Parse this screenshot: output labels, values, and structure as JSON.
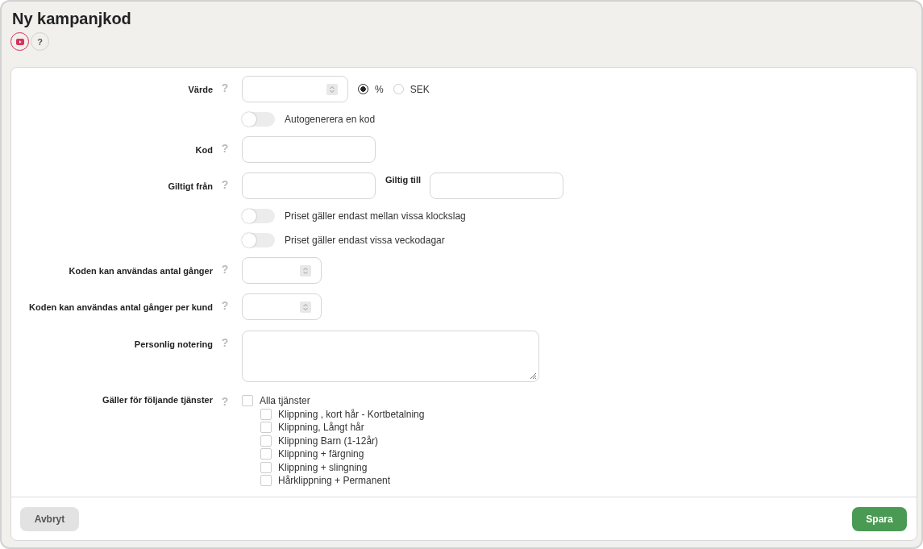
{
  "title": "Ny kampanjkod",
  "help_button": "?",
  "fields": [
    {
      "kind": "value",
      "label": "Värde",
      "help": "?",
      "options": [
        {
          "label": "%",
          "selected": true
        },
        {
          "label": "SEK",
          "selected": false
        }
      ]
    },
    {
      "kind": "toggle",
      "label": "Autogenerera en kod",
      "on": false
    },
    {
      "kind": "text",
      "label": "Kod",
      "help": "?"
    },
    {
      "kind": "daterange",
      "label": "Giltigt från",
      "help": "?",
      "second_label": "Giltig till"
    },
    {
      "kind": "toggle",
      "label": "Priset gäller endast mellan vissa klockslag",
      "on": false
    },
    {
      "kind": "toggle",
      "label": "Priset gäller endast vissa veckodagar",
      "on": false
    },
    {
      "kind": "number",
      "label": "Koden kan användas antal gånger",
      "help": "?"
    },
    {
      "kind": "number",
      "label": "Koden kan användas antal gånger per kund",
      "help": "?"
    },
    {
      "kind": "textarea",
      "label": "Personlig notering",
      "help": "?"
    },
    {
      "kind": "services",
      "label": "Gäller för följande tjänster",
      "help": "?",
      "items": [
        {
          "label": "Alla tjänster",
          "checked": false,
          "children": [
            {
              "label": "Klippning , kort hår - Kortbetalning",
              "checked": false
            },
            {
              "label": "Klippning, Långt hår",
              "checked": false
            },
            {
              "label": "Klippning Barn (1-12år)",
              "checked": false
            },
            {
              "label": "Klippning + färgning",
              "checked": false
            },
            {
              "label": "Klippning + slingning",
              "checked": false
            },
            {
              "label": "Hårklippning + Permanent",
              "checked": false
            }
          ]
        }
      ]
    }
  ],
  "buttons": {
    "cancel": "Avbryt",
    "save": "Spara"
  }
}
